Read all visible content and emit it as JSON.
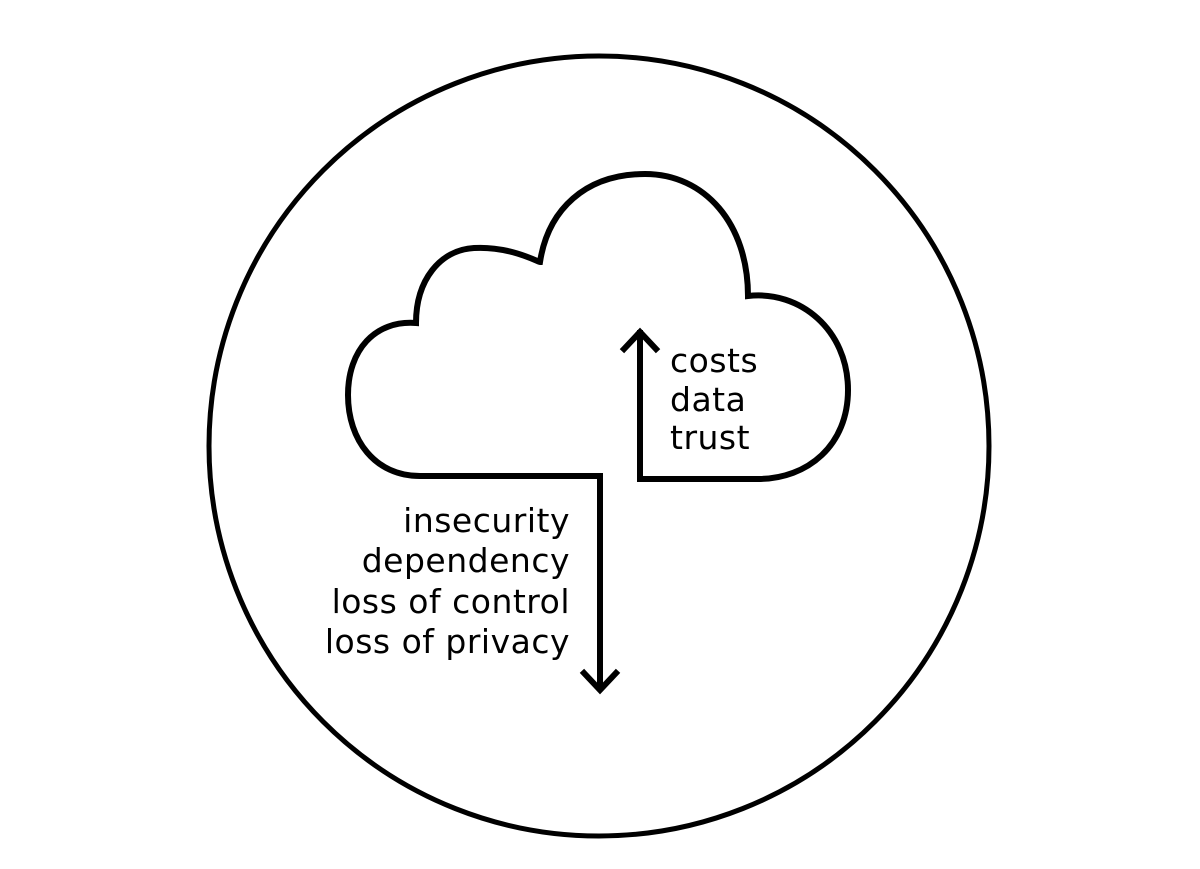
{
  "colors": {
    "stroke": "#000000",
    "background": "#ffffff"
  },
  "inflow": {
    "direction": "up",
    "items": [
      "costs",
      "data",
      "trust"
    ]
  },
  "outflow": {
    "direction": "down",
    "items": [
      "insecurity",
      "dependency",
      "loss of control",
      "loss of privacy"
    ]
  }
}
